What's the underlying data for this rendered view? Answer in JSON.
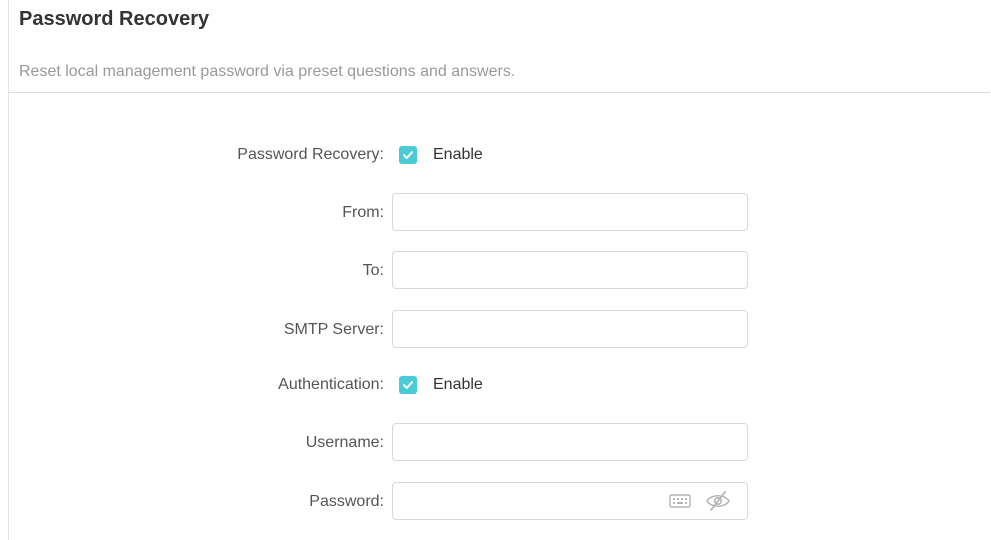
{
  "section": {
    "title": "Password Recovery",
    "description": "Reset local management password via preset questions and answers."
  },
  "form": {
    "password_recovery": {
      "label": "Password Recovery:",
      "checkbox_label": "Enable",
      "checked": true
    },
    "from": {
      "label": "From:",
      "value": ""
    },
    "to": {
      "label": "To:",
      "value": ""
    },
    "smtp_server": {
      "label": "SMTP Server:",
      "value": ""
    },
    "authentication": {
      "label": "Authentication:",
      "checkbox_label": "Enable",
      "checked": true
    },
    "username": {
      "label": "Username:",
      "value": ""
    },
    "password": {
      "label": "Password:",
      "value": "",
      "icons": [
        "keyboard-icon",
        "eye-slash-icon"
      ]
    }
  },
  "colors": {
    "accent": "#4acbd6",
    "label_text": "#555555",
    "description_text": "#999999",
    "input_border": "#d9d9d9"
  }
}
